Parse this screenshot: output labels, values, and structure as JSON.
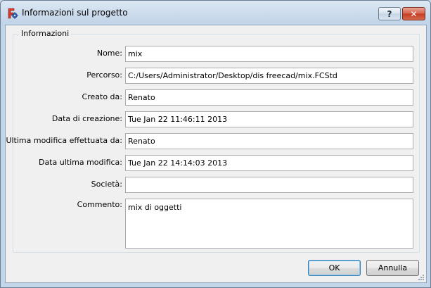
{
  "window": {
    "title": "Informazioni sul progetto",
    "help_label": "?",
    "close_label": "✕"
  },
  "group": {
    "title": "Informazioni"
  },
  "fields": [
    {
      "label": "Nome:",
      "value": "mix"
    },
    {
      "label": "Percorso:",
      "value": "C:/Users/Administrator/Desktop/dis freecad/mix.FCStd"
    },
    {
      "label": "Creato da:",
      "value": "Renato"
    },
    {
      "label": "Data di creazione:",
      "value": "Tue Jan 22 11:46:11 2013"
    },
    {
      "label": "Ultima modifica effettuata da:",
      "value": "Renato"
    },
    {
      "label": "Data ultima modifica:",
      "value": "Tue Jan 22 14:14:03 2013"
    },
    {
      "label": "Società:",
      "value": ""
    }
  ],
  "comment": {
    "label": "Commento:",
    "value": "mix di oggetti"
  },
  "buttons": {
    "ok": "OK",
    "cancel": "Annulla"
  },
  "icons": {
    "app": "freecad-gear-icon",
    "help": "help-icon",
    "close": "close-icon",
    "grip": "resize-grip-icon"
  }
}
